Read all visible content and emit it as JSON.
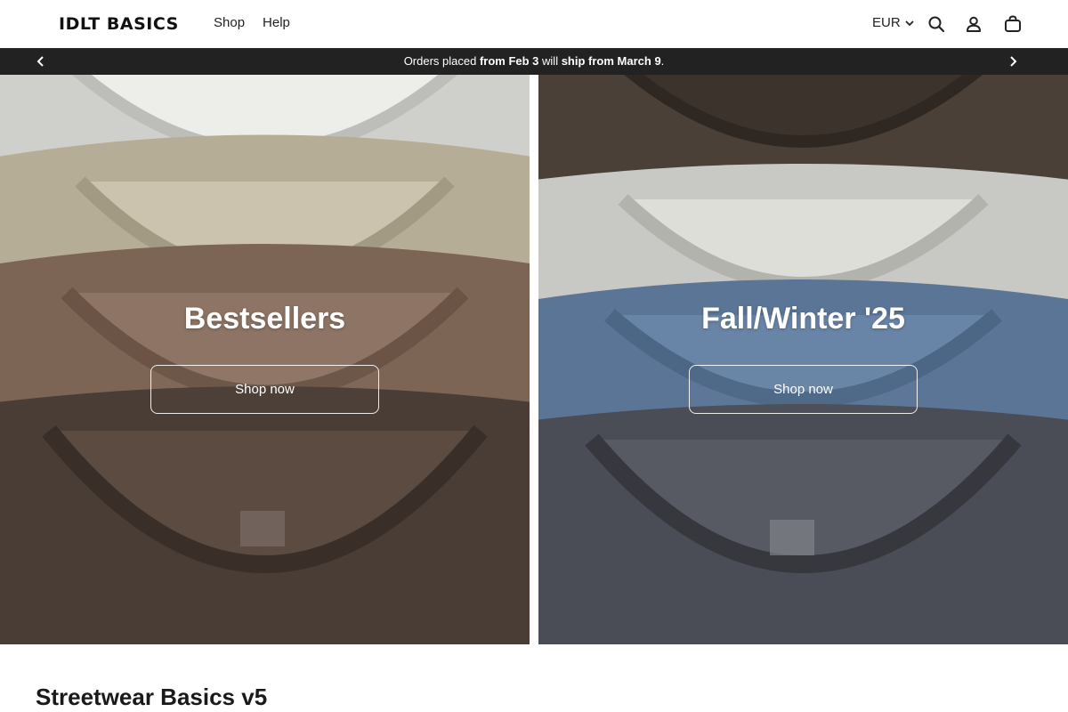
{
  "header": {
    "logo": "IDLT BASICS",
    "nav": [
      "Shop",
      "Help"
    ],
    "currency": "EUR",
    "icons": [
      "search-icon",
      "account-icon",
      "cart-icon"
    ]
  },
  "announcement": {
    "part1": "Orders placed ",
    "bold1": "from Feb 3",
    "part2": " will ",
    "bold2": "ship from March 9",
    "part3": "."
  },
  "hero": {
    "left": {
      "title": "Bestsellers",
      "button": "Shop now"
    },
    "right": {
      "title": "Fall/Winter '25",
      "button": "Shop now"
    }
  },
  "section": {
    "title": "Streetwear Basics v5"
  },
  "colors": {
    "announce_bg": "#222222",
    "accent": "#111111"
  }
}
